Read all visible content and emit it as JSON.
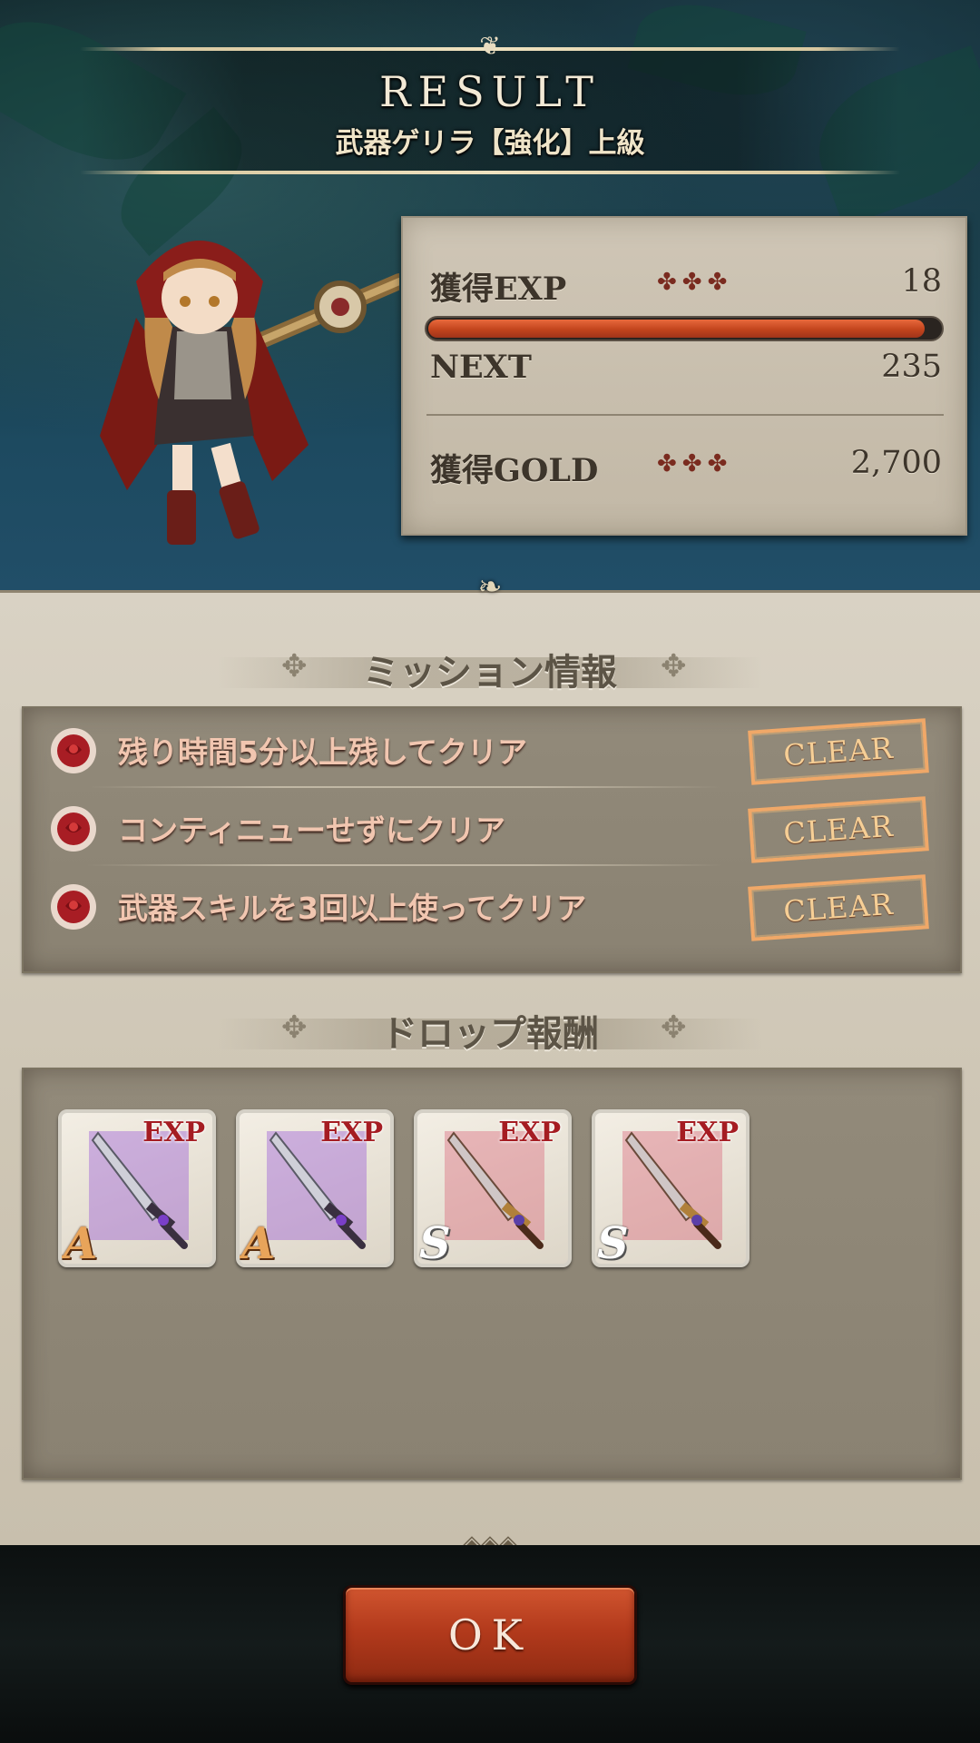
{
  "header": {
    "title": "RESULT",
    "quest_name": "武器ゲリラ【強化】上級"
  },
  "stats": {
    "exp_label": "獲得EXP",
    "exp_value": "18",
    "exp_bar_fill_ratio": 0.97,
    "next_label": "NEXT",
    "next_value": "235",
    "gold_label": "獲得GOLD",
    "gold_value": "2,700",
    "crosses": "✤✤✤"
  },
  "missions": {
    "heading": "ミッション情報",
    "items": [
      {
        "text": "残り時間5分以上残してクリア",
        "status": "CLEAR"
      },
      {
        "text": "コンティニューせずにクリア",
        "status": "CLEAR"
      },
      {
        "text": "武器スキルを3回以上使ってクリア",
        "status": "CLEAR"
      }
    ]
  },
  "drops": {
    "heading": "ドロップ報酬",
    "items": [
      {
        "tag": "EXP",
        "rank": "A",
        "color": "#8a3fd6"
      },
      {
        "tag": "EXP",
        "rank": "A",
        "color": "#8a3fd6"
      },
      {
        "tag": "EXP",
        "rank": "S",
        "color": "#d8506a"
      },
      {
        "tag": "EXP",
        "rank": "S",
        "color": "#d8506a"
      }
    ]
  },
  "footer": {
    "ok_label": "OK"
  },
  "colors": {
    "accent_red": "#b33a1c",
    "stamp": "#f0a868"
  }
}
